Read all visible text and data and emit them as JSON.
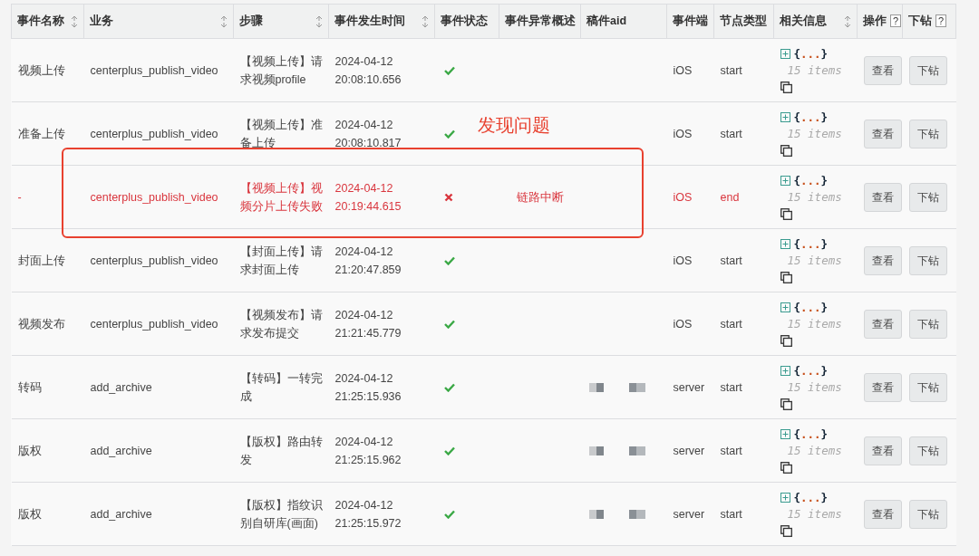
{
  "columns": [
    {
      "label": "事件名称",
      "sortable": true,
      "help": false
    },
    {
      "label": "业务",
      "sortable": true,
      "help": false
    },
    {
      "label": "步骤",
      "sortable": true,
      "help": false
    },
    {
      "label": "事件发生时间",
      "sortable": true,
      "help": false
    },
    {
      "label": "事件状态",
      "sortable": false,
      "help": false
    },
    {
      "label": "事件异常概述",
      "sortable": false,
      "help": false
    },
    {
      "label": "稿件aid",
      "sortable": false,
      "help": false
    },
    {
      "label": "事件端",
      "sortable": false,
      "help": false
    },
    {
      "label": "节点类型",
      "sortable": false,
      "help": false
    },
    {
      "label": "相关信息",
      "sortable": true,
      "help": false
    },
    {
      "label": "操作",
      "sortable": false,
      "help": true,
      "help_text": "?"
    },
    {
      "label": "下钻",
      "sortable": false,
      "help": true,
      "help_text": "?"
    }
  ],
  "rows": [
    {
      "name": "视频上传",
      "business": "centerplus_publish_video",
      "step": "【视频上传】请求视频profile",
      "time": "2024-04-12 20:08:10.656",
      "failed": false,
      "summary": "",
      "aid_redacted": false,
      "client": "iOS",
      "node_type": "start",
      "info": "{...}",
      "info_count": "15 items",
      "error": false,
      "annotated": false,
      "view": "查看",
      "drill": "下钻"
    },
    {
      "name": "准备上传",
      "business": "centerplus_publish_video",
      "step": "【视频上传】准备上传",
      "time": "2024-04-12 20:08:10.817",
      "failed": false,
      "summary": "",
      "aid_redacted": false,
      "client": "iOS",
      "node_type": "start",
      "info": "{...}",
      "info_count": "15 items",
      "error": false,
      "annotated": false,
      "view": "查看",
      "drill": "下钻"
    },
    {
      "name": "-",
      "business": "centerplus_publish_video",
      "step": "【视频上传】视频分片上传失败",
      "time": "2024-04-12 20:19:44.615",
      "failed": true,
      "summary": "链路中断",
      "aid_redacted": false,
      "client": "iOS",
      "node_type": "end",
      "info": "{...}",
      "info_count": "15 items",
      "error": true,
      "annotated": true,
      "view": "查看",
      "drill": "下钻"
    },
    {
      "name": "封面上传",
      "business": "centerplus_publish_video",
      "step": "【封面上传】请求封面上传",
      "time": "2024-04-12 21:20:47.859",
      "failed": false,
      "summary": "",
      "aid_redacted": false,
      "client": "iOS",
      "node_type": "start",
      "info": "{...}",
      "info_count": "15 items",
      "error": false,
      "annotated": false,
      "view": "查看",
      "drill": "下钻"
    },
    {
      "name": "视频发布",
      "business": "centerplus_publish_video",
      "step": "【视频发布】请求发布提交",
      "time": "2024-04-12 21:21:45.779",
      "failed": false,
      "summary": "",
      "aid_redacted": false,
      "client": "iOS",
      "node_type": "start",
      "info": "{...}",
      "info_count": "15 items",
      "error": false,
      "annotated": false,
      "view": "查看",
      "drill": "下钻"
    },
    {
      "name": "转码",
      "business": "add_archive",
      "step": "【转码】一转完成",
      "time": "2024-04-12 21:25:15.936",
      "failed": false,
      "summary": "",
      "aid_redacted": true,
      "client": "server",
      "node_type": "start",
      "info": "{...}",
      "info_count": "15 items",
      "error": false,
      "annotated": false,
      "view": "查看",
      "drill": "下钻"
    },
    {
      "name": "版权",
      "business": "add_archive",
      "step": "【版权】路由转发",
      "time": "2024-04-12 21:25:15.962",
      "failed": false,
      "summary": "",
      "aid_redacted": true,
      "client": "server",
      "node_type": "start",
      "info": "{...}",
      "info_count": "15 items",
      "error": false,
      "annotated": false,
      "view": "查看",
      "drill": "下钻"
    },
    {
      "name": "版权",
      "business": "add_archive",
      "step": "【版权】指纹识别自研库(画面)",
      "time": "2024-04-12 21:25:15.972",
      "failed": false,
      "summary": "",
      "aid_redacted": true,
      "client": "server",
      "node_type": "start",
      "info": "{...}",
      "info_count": "15 items",
      "error": false,
      "annotated": false,
      "view": "查看",
      "drill": "下钻"
    }
  ],
  "annotation": {
    "text": "发现问题"
  }
}
